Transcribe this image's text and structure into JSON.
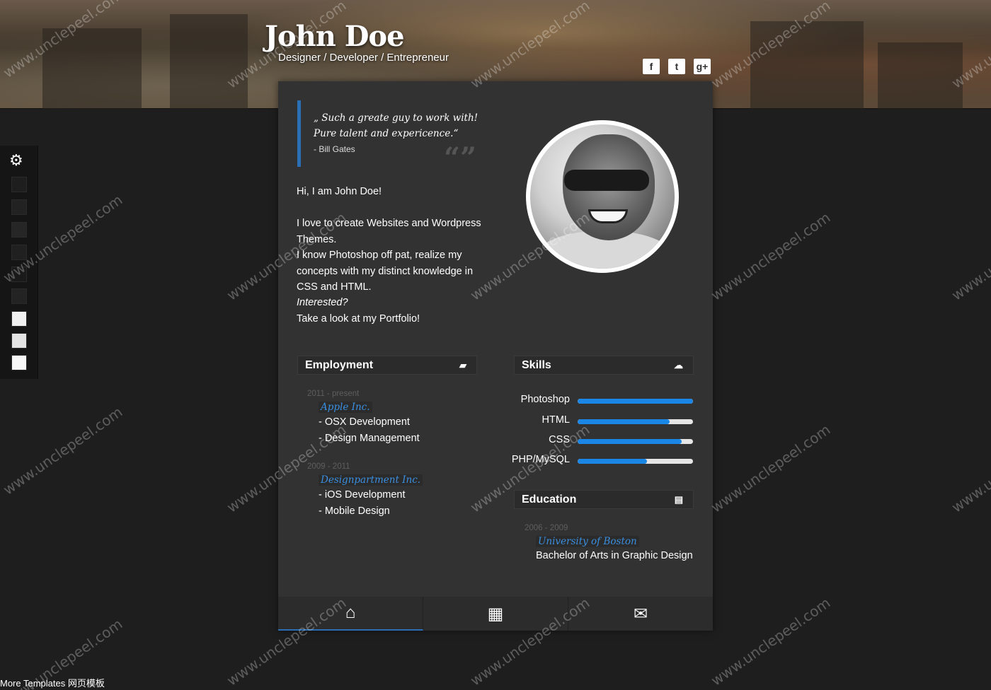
{
  "header": {
    "name": "John Doe",
    "subtitle": "Designer / Developer / Entrepreneur",
    "social": [
      {
        "icon": "facebook-icon",
        "glyph": "f"
      },
      {
        "icon": "twitter-icon",
        "glyph": "t"
      },
      {
        "icon": "google-plus-icon",
        "glyph": "g+"
      }
    ]
  },
  "quote": {
    "text": "„ Such a greate guy to work with! Pure talent and expericence.“",
    "author": "- Bill Gates"
  },
  "intro": {
    "greeting": "Hi, I am John Doe!",
    "line1": "I love to create Websites and Wordpress Themes.",
    "line2": "I know Photoshop off pat, realize my concepts with my distinct knowledge in CSS and HTML.",
    "line3": "Interested?",
    "line4": "Take a look at my Portfolio!"
  },
  "employment": {
    "title": "Employment",
    "jobs": [
      {
        "date": "2011 - present",
        "company": "Apple Inc.",
        "items": [
          "- OSX Development",
          "- Design Management"
        ]
      },
      {
        "date": "2009 - 2011",
        "company": "Designpartment Inc.",
        "items": [
          "- iOS Development",
          "- Mobile Design"
        ]
      }
    ]
  },
  "skills": {
    "title": "Skills",
    "items": [
      {
        "label": "Photoshop",
        "level": 1.0
      },
      {
        "label": "HTML",
        "level": 0.8
      },
      {
        "label": "CSS",
        "level": 0.9
      },
      {
        "label": "PHP/MySQL",
        "level": 0.6
      }
    ]
  },
  "education": {
    "title": "Education",
    "date": "2006 - 2009",
    "school": "University of Boston",
    "degree": "Bachelor of Arts in Graphic Design"
  },
  "tabs": [
    {
      "icon": "home-icon",
      "glyph": "⌂",
      "active": true
    },
    {
      "icon": "grid-icon",
      "glyph": "▦",
      "active": false
    },
    {
      "icon": "mail-icon",
      "glyph": "✉",
      "active": false
    }
  ],
  "switcher": {
    "icon": "gears-icon",
    "swatches": [
      "#1e1e1e",
      "#222222",
      "#262626",
      "#202020",
      "#1a1a1a",
      "#232323",
      "#f0f0f0",
      "#e4e4e4",
      "#f7f7f7"
    ]
  },
  "footer": {
    "link": "More Templates 网页模板"
  },
  "watermark": "www.unclepeel.com",
  "colors": {
    "accent": "#2a6fb5",
    "skill_bar": "#1a86e6",
    "link": "#3a8fe0"
  }
}
